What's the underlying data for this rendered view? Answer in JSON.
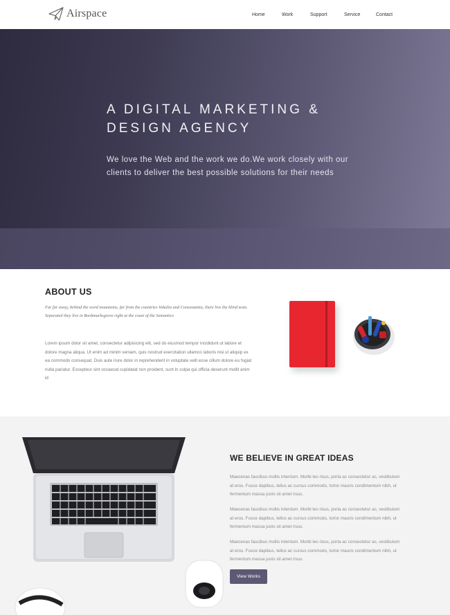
{
  "header": {
    "logo_text": "Airspace",
    "logo_icon": "paper-plane-icon",
    "nav": [
      "Home",
      "Work",
      "Support",
      "Service",
      "Contact"
    ]
  },
  "hero": {
    "title_lines": [
      "A DIGITAL MARKETING &",
      "DESIGN AGENCY"
    ],
    "subtitle_lines": [
      "We love the Web and the work we do.We work closely with our",
      "clients to deliver the best possible solutions for their needs"
    ]
  },
  "about": {
    "title": "ABOUT US",
    "italic": "Far far away, behind the word mountains, far from the countries Vokalia and Consonantia, there live the blind texts. Separated they live in Bookmarksgrove right at the coast of the Semantics",
    "body": "Lorem ipsum dolor sit amet, consectetur adipisicing elit, sed do eiusmod tempor incididunt ut labore et dolore magna aliqua. Ut enim ad minim veniam, quis nostrud exercitation ullamco laboris nisi ut aliquip ex ea commodo consequat. Duis aute irure dolor in reprehenderit in voluptate velit esse cillum dolore eu fugiat nulla pariatur. Excepteur sint occaecat cupidatat non proident, sunt in culpa qui officia deserunt mollit anim id"
  },
  "ideas": {
    "title": "WE BELIEVE IN GREAT IDEAS",
    "paragraphs": [
      "Maecenas faucibus mollis interdum. Morbi leo risus, porta ac consectetur ac, vestibulum at eros. Fusce dapibus, tellus ac cursus commodo, tortor mauris condimentum nibh, ut fermentum massa justo sit amet risus.",
      "Maecenas faucibus mollis interdum. Morbi leo risus, porta ac consectetur ac, vestibulum at eros. Fusce dapibus, tellus ac cursus commodo, tortor mauris condimentum nibh, ut fermentum massa justo sit amet risus.",
      "Maecenas faucibus mollis interdum. Morbi leo risus, porta ac consectetur ac, vestibulum at eros. Fusce dapibus, tellus ac cursus commodo, tortor mauris condimentum nibh, ut fermentum massa justo sit amet risus."
    ],
    "button_label": "View Works"
  },
  "colors": {
    "hero_dark": "#2e2b3f",
    "hero_light": "#7f7b98",
    "button": "#5d5873",
    "notebook": "#e8262f"
  }
}
